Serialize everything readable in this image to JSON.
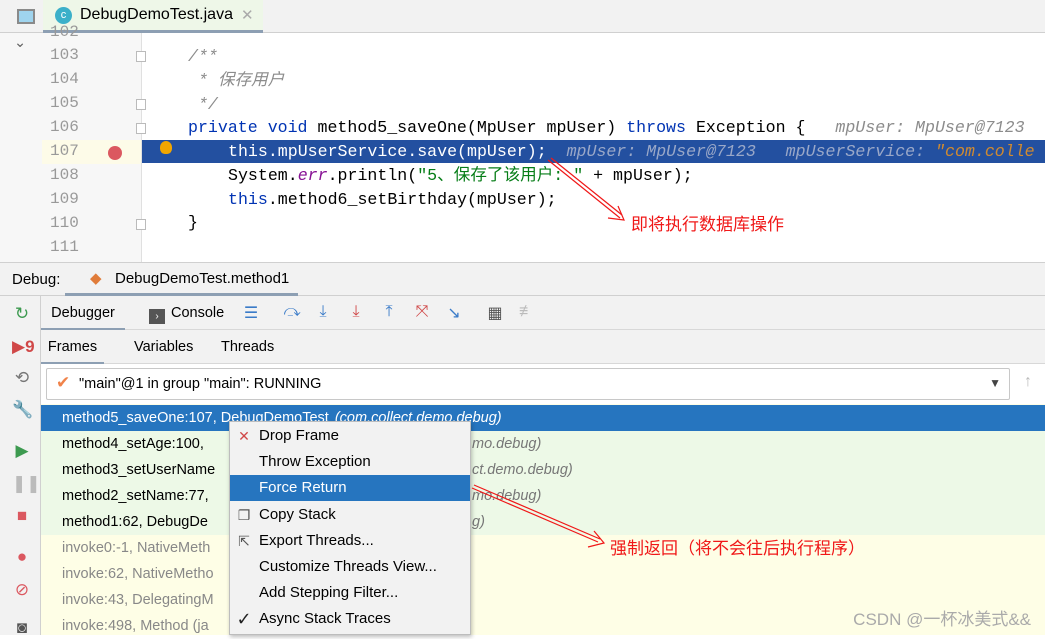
{
  "editor": {
    "file_tab": "DebugDemoTest.java",
    "lines": [
      {
        "n": "102"
      },
      {
        "n": "103"
      },
      {
        "n": "104"
      },
      {
        "n": "105"
      },
      {
        "n": "106"
      },
      {
        "n": "107"
      },
      {
        "n": "108"
      },
      {
        "n": "109"
      },
      {
        "n": "110"
      },
      {
        "n": "111"
      }
    ],
    "code": {
      "l103": "/**",
      "l104": " * 保存用户",
      "l105": " */",
      "l106_kw1": "private",
      "l106_kw2": "void",
      "l106_rest": "method5_saveOne(MpUser mpUser)",
      "l106_kw3": "throws",
      "l106_end": "Exception {",
      "l106_hint": "mpUser: MpUser@7123",
      "l107": "this.mpUserService.save(mpUser);",
      "l107_hint1": "mpUser: MpUser@7123",
      "l107_hint2": "mpUserService: ",
      "l107_hint3": "\"com.colle",
      "l108_a": "System.",
      "l108_b": "err",
      "l108_c": ".println(",
      "l108_str": "\"5、保存了该用户: \"",
      "l108_d": " + mpUser);",
      "l109_kw": "this",
      "l109_rest": ".method6_setBirthday(mpUser);",
      "l110": "}"
    },
    "annotation": "即将执行数据库操作"
  },
  "debug": {
    "label": "Debug:",
    "session_tab": "DebugDemoTest.method1",
    "tabs": {
      "debugger": "Debugger",
      "console": "Console"
    },
    "subtabs": {
      "frames": "Frames",
      "variables": "Variables",
      "threads": "Threads"
    },
    "thread": "\"main\"@1 in group \"main\": RUNNING",
    "frames": [
      {
        "left": "method5_saveOne:107, DebugDemoTest",
        "right": "(com.collect.demo.debug)",
        "style": "selected"
      },
      {
        "left": "method4_setAge:100,",
        "right": "mo.debug)",
        "style": "green"
      },
      {
        "left": "method3_setUserName",
        "right": "ct.demo.debug)",
        "style": "green"
      },
      {
        "left": "method2_setName:77,",
        "right": "mo.debug)",
        "style": "green"
      },
      {
        "left": "method1:62, DebugDe",
        "right": "g)",
        "style": "green"
      },
      {
        "left": "invoke0:-1, NativeMeth",
        "right": "",
        "style": "library"
      },
      {
        "left": "invoke:62, NativeMetho",
        "right": "",
        "style": "library"
      },
      {
        "left": "invoke:43, DelegatingM",
        "right": "",
        "style": "library"
      },
      {
        "left": "invoke:498, Method (ja",
        "right": "",
        "style": "library"
      }
    ],
    "annotation": "强制返回（将不会往后执行程序）"
  },
  "context_menu": {
    "items": [
      {
        "label": "Drop Frame",
        "icon": "drop-frame-icon"
      },
      {
        "label": "Throw Exception",
        "icon": ""
      },
      {
        "label": "Force Return",
        "icon": "",
        "active": true
      },
      {
        "label": "Copy Stack",
        "icon": "copy-icon"
      },
      {
        "label": "Export Threads...",
        "icon": "export-icon"
      },
      {
        "label": "Customize Threads View...",
        "icon": ""
      },
      {
        "label": "Add Stepping Filter...",
        "icon": ""
      },
      {
        "label": "Async Stack Traces",
        "icon": "checkmark-icon"
      }
    ]
  },
  "watermark": "CSDN @一杯冰美式&&",
  "colors": {
    "selection": "#2675bf",
    "exec_line": "#2350a0",
    "annotation": "#f01818"
  }
}
